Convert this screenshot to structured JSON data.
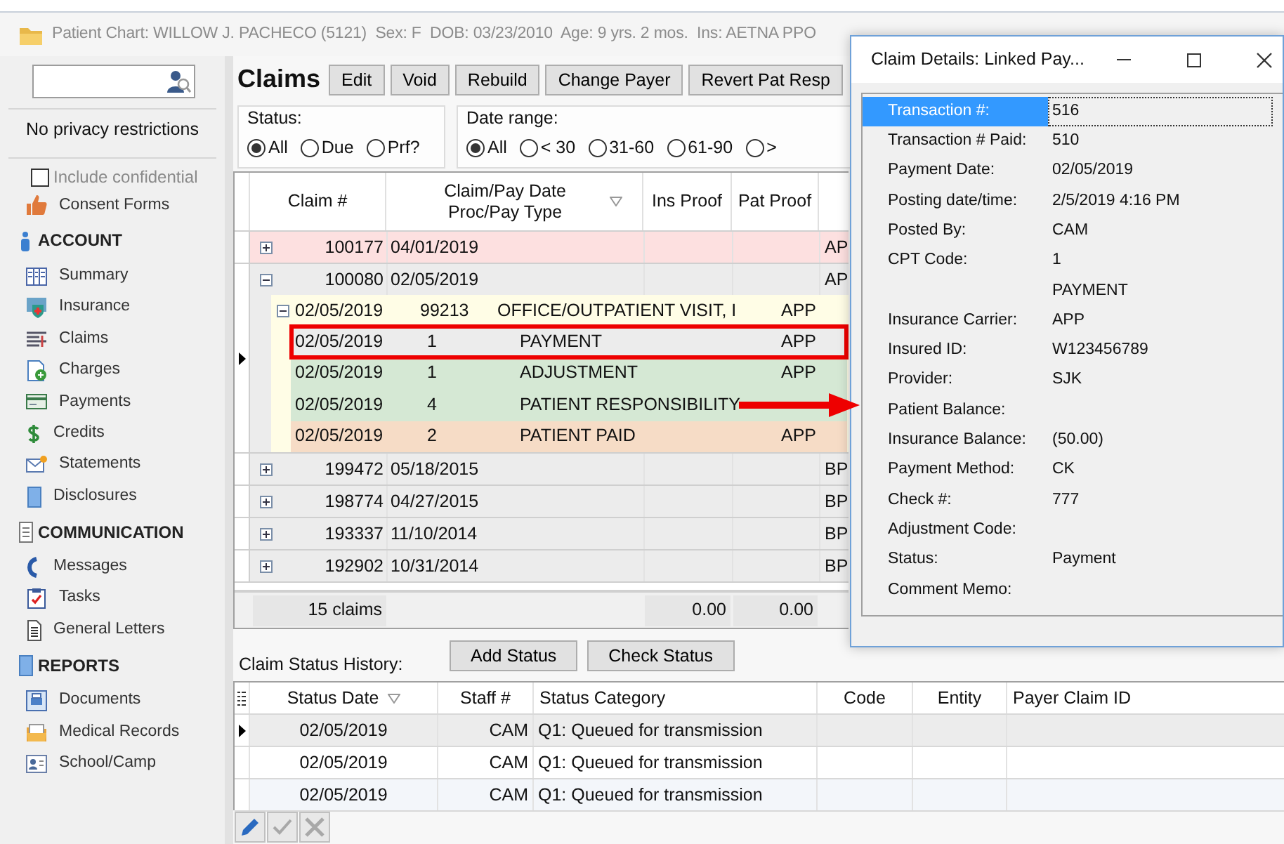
{
  "main_window": {
    "title": "Patient Chart: WILLOW J. PACHECO (5121)  Sex: F  DOB: 03/23/2010  Age: 9 yrs. 2 mos.  Ins: AETNA PPO",
    "sidebar": {
      "privacy_note": "No privacy restrictions",
      "include_confidential": {
        "label": "Include confidential",
        "checked": false,
        "disabled": true
      },
      "items": [
        {
          "kind": "link",
          "label": "Consent Forms"
        },
        {
          "kind": "section",
          "label": "ACCOUNT"
        },
        {
          "kind": "link",
          "label": "Summary"
        },
        {
          "kind": "link",
          "label": "Insurance"
        },
        {
          "kind": "link",
          "label": "Claims"
        },
        {
          "kind": "link",
          "label": "Charges"
        },
        {
          "kind": "link",
          "label": "Payments"
        },
        {
          "kind": "link",
          "label": "Credits"
        },
        {
          "kind": "link",
          "label": "Statements"
        },
        {
          "kind": "link",
          "label": "Disclosures"
        },
        {
          "kind": "section",
          "label": "COMMUNICATION"
        },
        {
          "kind": "link",
          "label": "Messages"
        },
        {
          "kind": "link",
          "label": "Tasks"
        },
        {
          "kind": "link",
          "label": "General Letters"
        },
        {
          "kind": "section",
          "label": "REPORTS"
        },
        {
          "kind": "link",
          "label": "Documents"
        },
        {
          "kind": "link",
          "label": "Medical Records"
        },
        {
          "kind": "link",
          "label": "School/Camp"
        }
      ]
    },
    "claims": {
      "heading": "Claims",
      "buttons": [
        "Edit",
        "Void",
        "Rebuild",
        "Change Payer",
        "Revert Pat Resp"
      ],
      "status_filter": {
        "label": "Status:",
        "options": [
          {
            "label": "All",
            "selected": true
          },
          {
            "label": "Due",
            "selected": false
          },
          {
            "label": "Prf?",
            "selected": false
          }
        ]
      },
      "date_range": {
        "label": "Date range:",
        "options": [
          {
            "label": "All",
            "selected": true
          },
          {
            "label": "< 30",
            "selected": false
          },
          {
            "label": "31-60",
            "selected": false
          },
          {
            "label": "61-90",
            "selected": false
          },
          {
            "label": ">",
            "selected": false
          }
        ]
      },
      "grid": {
        "columns": [
          {
            "label": "Claim #",
            "sorted": false
          },
          {
            "label": "Claim/Pay Date Proc/Pay Type",
            "sorted": true
          },
          {
            "label": "Ins Proof",
            "sorted": false
          },
          {
            "label": "Pat Proof",
            "sorted": false
          }
        ],
        "rows": [
          {
            "kind": "claim",
            "claim_no": "100177",
            "date": "04/01/2019",
            "column_5": "AP",
            "expanded": false,
            "selected": false,
            "color": "#fde0e0"
          },
          {
            "kind": "claim",
            "claim_no": "100080",
            "date": "02/05/2019",
            "column_5": "AP",
            "expanded": true,
            "selected": true,
            "color": "#ececec",
            "children": [
              {
                "kind": "charge",
                "date": "02/05/2019",
                "code": "99213",
                "description": "OFFICE/OUTPATIENT VISIT, I",
                "payer": "APP",
                "expanded": true,
                "children": [
                  {
                    "kind": "transaction",
                    "date": "02/05/2019",
                    "code": "1",
                    "description": "PAYMENT",
                    "payer": "APP",
                    "selected": true,
                    "outlined": true
                  },
                  {
                    "kind": "transaction",
                    "date": "02/05/2019",
                    "code": "1",
                    "description": "ADJUSTMENT",
                    "payer": "APP",
                    "selected": false,
                    "outlined": false,
                    "color": "#d5e8d4"
                  },
                  {
                    "kind": "transaction",
                    "date": "02/05/2019",
                    "code": "4",
                    "description": "PATIENT RESPONSIBILITY",
                    "selected": false,
                    "outlined": false,
                    "color": "#d5e8d4"
                  },
                  {
                    "kind": "transaction",
                    "date": "02/05/2019",
                    "code": "2",
                    "description": "PATIENT PAID",
                    "payer": "APP",
                    "selected": false,
                    "outlined": false,
                    "color": "#f6dcc6"
                  }
                ]
              }
            ]
          },
          {
            "kind": "claim",
            "claim_no": "199472",
            "date": "05/18/2015",
            "column_5": "BP",
            "expanded": false,
            "selected": false,
            "color": "#ececec"
          },
          {
            "kind": "claim",
            "claim_no": "198774",
            "date": "04/27/2015",
            "column_5": "BP",
            "expanded": false,
            "selected": false,
            "color": "#ececec"
          },
          {
            "kind": "claim",
            "claim_no": "193337",
            "date": "11/10/2014",
            "column_5": "BP",
            "expanded": false,
            "selected": false,
            "color": "#ececec"
          },
          {
            "kind": "claim",
            "claim_no": "192902",
            "date": "10/31/2014",
            "column_5": "BP",
            "expanded": false,
            "selected": false,
            "color": "#ececec"
          }
        ],
        "footer": {
          "count": "15 claims",
          "ins_proof_total": "0.00",
          "pat_proof_total": "0.00"
        }
      }
    },
    "status_history": {
      "label": "Claim Status History:",
      "buttons": [
        "Add Status",
        "Check Status"
      ],
      "columns": [
        {
          "label": "Status Date",
          "sorted": true
        },
        {
          "label": "Staff #",
          "sorted": false
        },
        {
          "label": "Status Category",
          "sorted": false
        },
        {
          "label": "Code",
          "sorted": false
        },
        {
          "label": "Entity",
          "sorted": false
        },
        {
          "label": "Payer Claim ID",
          "sorted": false
        }
      ],
      "rows": [
        {
          "status_date": "02/05/2019",
          "staff": "CAM",
          "category": "Q1: Queued for transmission",
          "selected": true
        },
        {
          "status_date": "02/05/2019",
          "staff": "CAM",
          "category": "Q1: Queued for transmission",
          "selected": false
        },
        {
          "status_date": "02/05/2019",
          "staff": "CAM",
          "category": "Q1: Queued for transmission",
          "selected": false
        }
      ]
    },
    "toolbar": [
      {
        "kind": "edit",
        "disabled": false
      },
      {
        "kind": "confirm",
        "disabled": true
      },
      {
        "kind": "cancel",
        "disabled": true
      }
    ]
  },
  "dialog": {
    "title": "Claim Details: Linked Pay...",
    "fields": [
      {
        "label": "Transaction #:",
        "value": "516",
        "selected": true
      },
      {
        "label": "Transaction # Paid:",
        "value": "510",
        "selected": false
      },
      {
        "label": "Payment Date:",
        "value": "02/05/2019",
        "selected": false
      },
      {
        "label": "Posting date/time:",
        "value": "2/5/2019 4:16 PM",
        "selected": false
      },
      {
        "label": "Posted By:",
        "value": "CAM",
        "selected": false
      },
      {
        "label": "CPT Code:",
        "value": "1",
        "selected": false
      },
      {
        "value": "PAYMENT",
        "selected": false
      },
      {
        "label": "Insurance Carrier:",
        "value": "APP",
        "selected": false
      },
      {
        "label": "Insured ID:",
        "value": "W123456789",
        "selected": false
      },
      {
        "label": "Provider:",
        "value": "SJK",
        "selected": false
      },
      {
        "label": "Patient Balance:",
        "selected": false
      },
      {
        "label": "Insurance Balance:",
        "value": "(50.00)",
        "selected": false
      },
      {
        "label": "Payment Method:",
        "value": "CK",
        "selected": false
      },
      {
        "label": "Check #:",
        "value": "777",
        "selected": false
      },
      {
        "label": "Adjustment Code:",
        "selected": false
      },
      {
        "label": "Status:",
        "value": "Payment",
        "selected": false
      },
      {
        "label": "Comment Memo:",
        "selected": false
      }
    ]
  }
}
